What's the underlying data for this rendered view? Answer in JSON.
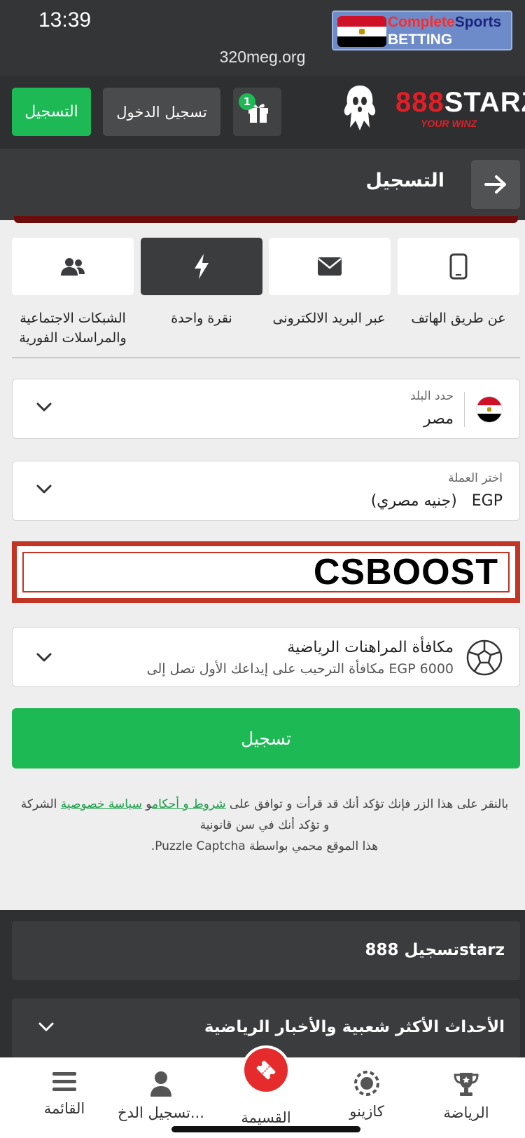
{
  "status_bar": {
    "time": "13:39",
    "url": "320meg.org",
    "badge_line1_red": "Complete",
    "badge_line1_blue": "Sports",
    "badge_line2": "BETTING"
  },
  "header": {
    "register_label": "التسجيل",
    "login_label": "تسجيل الدخول",
    "gift_count": "1",
    "brand_red": "888",
    "brand_white": "STARZ",
    "brand_tagline": "YOUR WINZ"
  },
  "title_bar": {
    "title": "التسجيل"
  },
  "reg_tabs": [
    {
      "label": "عن طريق الهاتف",
      "icon": "phone-icon"
    },
    {
      "label": "عبر البريد الالكترونى",
      "icon": "envelope-icon"
    },
    {
      "label": "نقرة واحدة",
      "icon": "lightning-icon"
    },
    {
      "label_line1": "الشبكات الاجتماعية",
      "label_line2": "والمراسلات الفورية",
      "icon": "users-icon"
    }
  ],
  "country_field": {
    "label": "حدد البلد",
    "value": "مصر"
  },
  "currency_field": {
    "label": "اختر العملة",
    "code": "EGP",
    "name": "(جنيه مصري)"
  },
  "promo_code": "CSBOOST",
  "bonus": {
    "title": "مكافأة المراهنات الرياضية",
    "subtitle": "مكافأة الترحيب على إيداعك الأول تصل إلى EGP 6000"
  },
  "register_button": "تسجيل",
  "terms": {
    "prefix": "بالنقر على هذا الزر فإنك تؤكد أنك قد قرأت و توافق على",
    "link_terms": "شروط و أحكام",
    "and": "و",
    "link_privacy": "سياسة خصوصية",
    "suffix": "الشركة",
    "line2": "و تؤكد أنك في سن قانونية",
    "line3": "هذا الموقع محمي بواسطة Puzzle Captcha."
  },
  "footer": {
    "item1": "تسجيل 888starz",
    "item2": "الأحداث الأكثر شعبية والأخبار الرياضية"
  },
  "bottom_nav": {
    "sports": "الرياضة",
    "casino": "كازينو",
    "coupon": "القسيمة",
    "login": "تسجيل الدخ...",
    "menu": "القائمة"
  },
  "colors": {
    "green": "#1db954",
    "brand_red": "#e21f26",
    "header_dark": "#2e2f31",
    "promo_border": "#c23424"
  }
}
